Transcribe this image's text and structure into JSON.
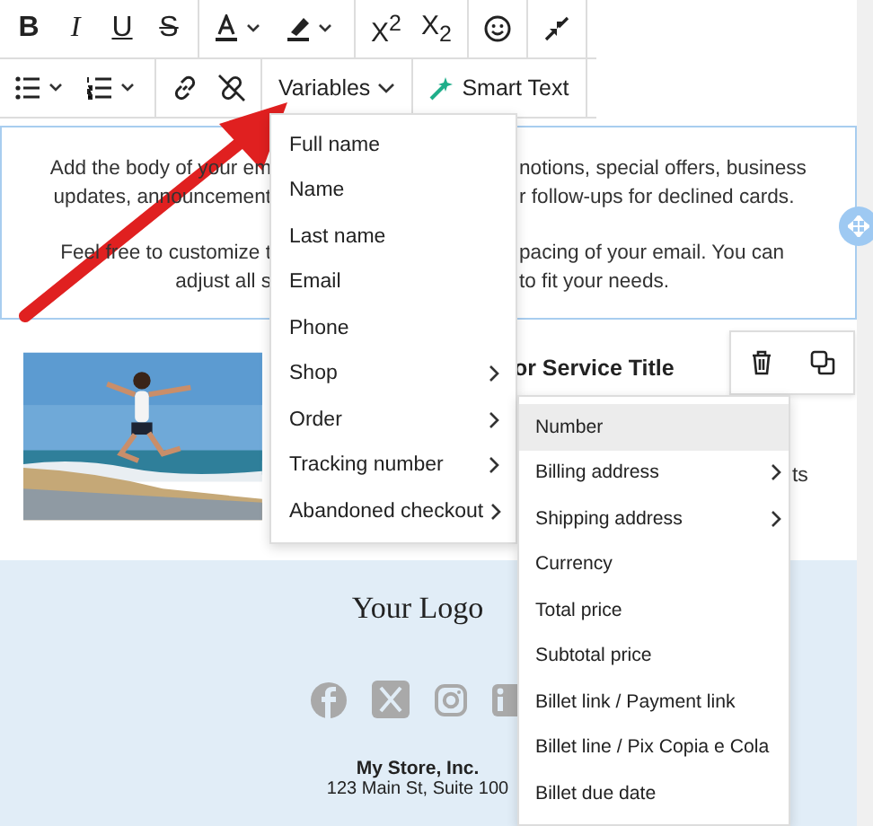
{
  "toolbar": {
    "format_buttons": [
      {
        "label": "B",
        "kind": "bold"
      },
      {
        "label": "I",
        "kind": "italic"
      },
      {
        "label": "U",
        "kind": "underline"
      },
      {
        "label": "S",
        "kind": "strike"
      }
    ],
    "script_buttons": [
      {
        "label": "X$^{2}$"
      },
      {
        "label": "X$_{2}$"
      }
    ],
    "variables": {
      "label": "Variables",
      "expanded": true
    },
    "smart_text": {
      "label": "Smart Text"
    }
  },
  "editor_text": {
    "paragraphs": [
      [
        {
          "left": "Add the body of your em",
          "right": "notions, special offers, business"
        },
        {
          "left": "updates, announcement",
          "right": "r follow-ups for declined cards."
        }
      ],
      [
        {
          "left": "Feel free to customize t",
          "right": "pacing of your email. You can"
        },
        {
          "left": "adjust all s",
          "right": "to fit your needs."
        }
      ]
    ]
  },
  "product": {
    "title_fragment": "or Service Title",
    "text_fragment": "ts"
  },
  "variables_menu": [
    {
      "label": "Full name",
      "has_submenu": false
    },
    {
      "label": "Name",
      "has_submenu": false
    },
    {
      "label": "Last name",
      "has_submenu": false
    },
    {
      "label": "Email",
      "has_submenu": false
    },
    {
      "label": "Phone",
      "has_submenu": false
    },
    {
      "label": "Shop",
      "has_submenu": true
    },
    {
      "label": "Order",
      "has_submenu": true
    },
    {
      "label": "Tracking number",
      "has_submenu": true
    },
    {
      "label": "Abandoned checkout",
      "has_submenu": true
    }
  ],
  "order_submenu": [
    {
      "label": "Number",
      "has_submenu": false,
      "selected": true
    },
    {
      "label": "Billing address",
      "has_submenu": true,
      "selected": false
    },
    {
      "label": "Shipping address",
      "has_submenu": true,
      "selected": false
    },
    {
      "label": "Currency",
      "has_submenu": false,
      "selected": false
    },
    {
      "label": "Total price",
      "has_submenu": false,
      "selected": false
    },
    {
      "label": "Subtotal price",
      "has_submenu": false,
      "selected": false
    },
    {
      "label": "Billet link / Payment link",
      "has_submenu": false,
      "selected": false
    },
    {
      "label": "Billet line / Pix Copia e Cola",
      "has_submenu": false,
      "selected": false
    },
    {
      "label": "Billet due date",
      "has_submenu": false,
      "selected": false
    }
  ],
  "footer": {
    "logo": "Your Logo",
    "company": "My Store, Inc.",
    "address": "123 Main St, Suite 100"
  }
}
